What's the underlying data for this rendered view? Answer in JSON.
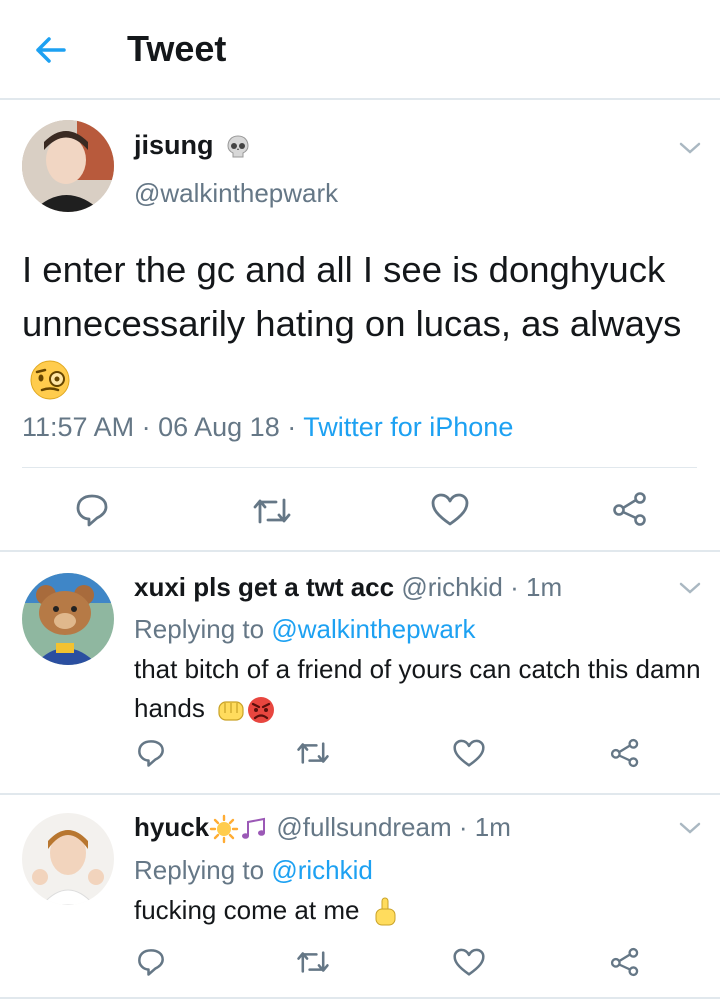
{
  "header": {
    "title": "Tweet"
  },
  "tweet": {
    "name": "jisung",
    "handle": "@walkinthepwark",
    "text": "I enter the gc and all I see is donghyuck unnecessarily hating on lucas, as always",
    "time": "11:57 AM",
    "date": "06 Aug 18",
    "source": "Twitter for iPhone"
  },
  "replies": [
    {
      "name": "xuxi pls get a twt acc",
      "handle": "@richkid",
      "time": "1m",
      "replying_label": "Replying to",
      "replying_to": "@walkinthepwark",
      "text": "that bitch of a friend of yours can catch this damn hands"
    },
    {
      "name": "hyuck",
      "handle": "@fullsundream",
      "time": "1m",
      "replying_label": "Replying to",
      "replying_to": "@richkid",
      "text": "fucking come at me"
    }
  ],
  "colors": {
    "accent": "#1da1f2",
    "muted": "#657786",
    "text": "#14171a",
    "border": "#e1e8ed"
  },
  "icons": [
    "back-arrow-icon",
    "skull-icon",
    "chevron-down-icon",
    "reply-icon",
    "retweet-icon",
    "like-icon",
    "share-icon",
    "monocle-face-icon",
    "fist-icon",
    "angry-face-icon",
    "sun-icon",
    "music-notes-icon",
    "middle-finger-icon"
  ]
}
